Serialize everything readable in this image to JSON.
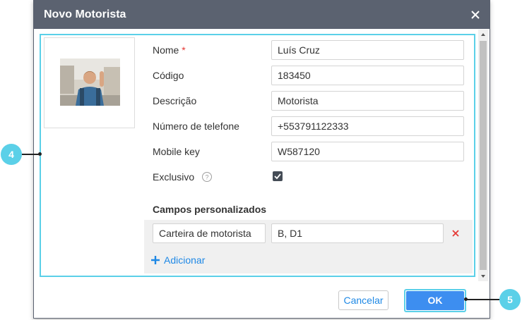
{
  "dialog": {
    "title": "Novo Motorista",
    "close_icon": "close-icon"
  },
  "form": {
    "fields": [
      {
        "label": "Nome",
        "required_mark": "*",
        "value": "Luís Cruz"
      },
      {
        "label": "Código",
        "value": "183450"
      },
      {
        "label": "Descrição",
        "value": "Motorista"
      },
      {
        "label": "Número de telefone",
        "value": "+553791122333"
      },
      {
        "label": "Mobile key",
        "value": "W587120"
      }
    ],
    "exclusive": {
      "label": "Exclusivo",
      "checked": true,
      "help_icon": "help-icon"
    }
  },
  "custom_fields": {
    "title": "Campos personalizados",
    "items": [
      {
        "name": "Carteira de motorista",
        "value": "B, D1"
      }
    ],
    "add_label": "Adicionar"
  },
  "footer": {
    "cancel_label": "Cancelar",
    "ok_label": "OK"
  },
  "callouts": {
    "left": "4",
    "right": "5"
  },
  "colors": {
    "titlebar": "#5b6270",
    "highlight": "#5bd0e8",
    "primary": "#3d8ef0",
    "link": "#1e88e5",
    "delete": "#e53935"
  }
}
